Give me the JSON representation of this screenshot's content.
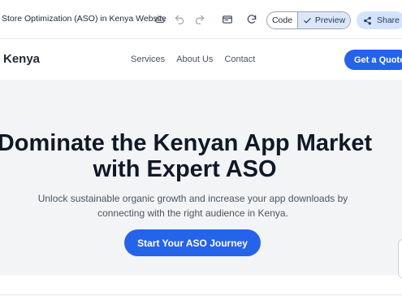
{
  "toolbar": {
    "title": "Store Optimization (ASO) in Kenya Website",
    "icons": [
      "cloud-sync-icon",
      "undo-icon",
      "redo-icon",
      "preview-window-icon",
      "refresh-icon"
    ],
    "code_label": "Code",
    "preview_label": "Preview",
    "share_label": "Share"
  },
  "site": {
    "brand": "Kenya",
    "nav": [
      "Services",
      "About Us",
      "Contact"
    ],
    "quote_label": "Get a Quote"
  },
  "hero": {
    "title_line1": "Dominate the Kenyan App Market",
    "title_line2": "with Expert ASO",
    "sub_line1": "Unlock sustainable organic growth and increase your app downloads by",
    "sub_line2": "connecting with the right audience in Kenya.",
    "cta_label": "Start Your ASO Journey"
  },
  "colors": {
    "accent": "#2563eb",
    "preview_bg": "#dbe7f7",
    "share_bg": "#d3e3fd",
    "hero_bg": "#f3f4f6"
  }
}
